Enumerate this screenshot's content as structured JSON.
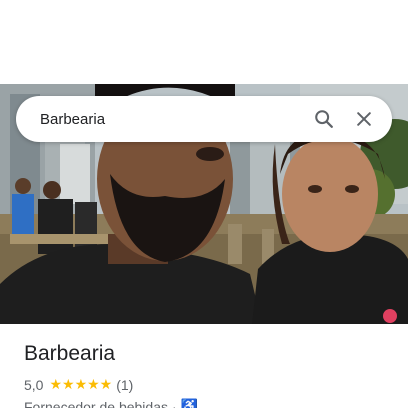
{
  "search": {
    "query": "Barbearia",
    "search_icon": "search-icon",
    "close_icon": "close-icon"
  },
  "photo": {
    "description_icon": "place-photo"
  },
  "place": {
    "title": "Barbearia",
    "rating": "5,0",
    "stars_count": 5,
    "stars": "★★★★★",
    "reviews": "(1)",
    "category": "Fornecedor de bebidas",
    "separator": "·",
    "accessibility_icon": "wheelchair-icon",
    "accessibility_glyph": "♿"
  },
  "colors": {
    "star": "#fbbc04",
    "title": "#202124",
    "secondary": "#5f6368",
    "accessibility": "#1a73e8"
  }
}
